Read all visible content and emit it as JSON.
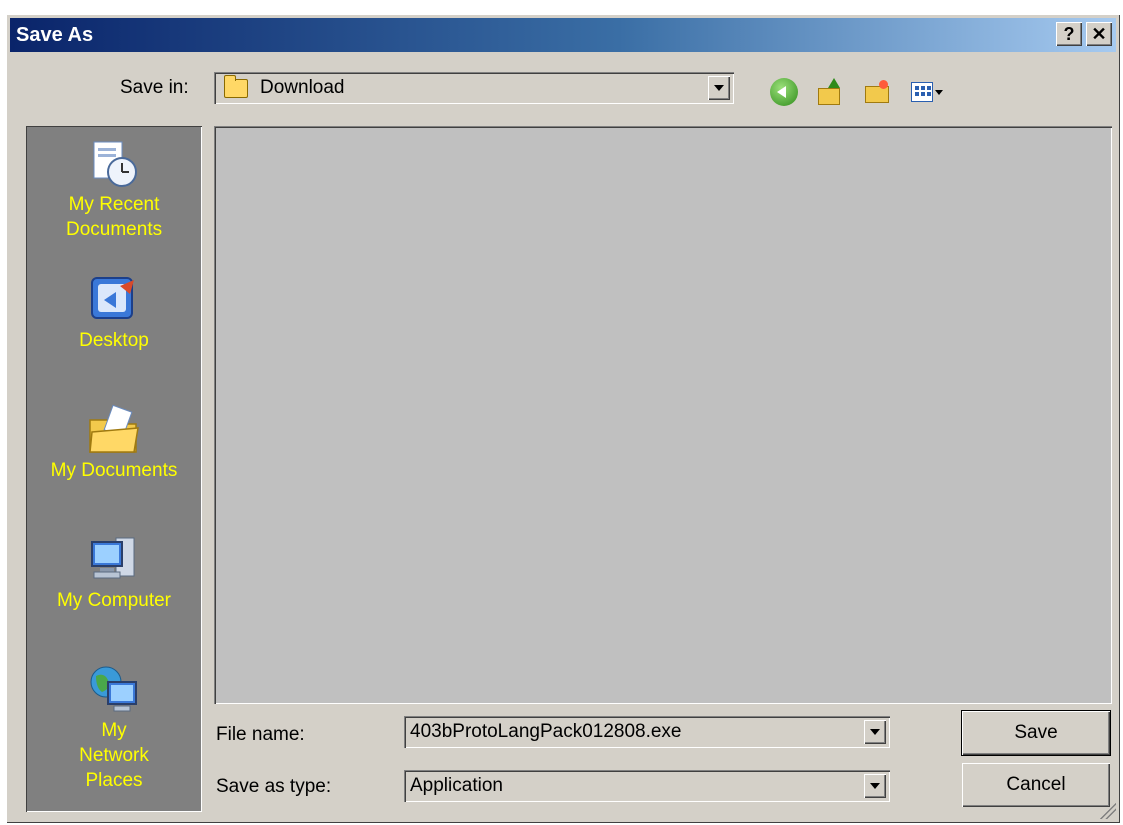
{
  "dialog": {
    "title": "Save As",
    "help_button": "?",
    "close_button": "✕"
  },
  "save_in": {
    "label": "Save in:",
    "value": "Download"
  },
  "toolbar": {
    "back": "back-icon",
    "up": "up-one-level-icon",
    "new_folder": "new-folder-icon",
    "views": "views-menu-icon"
  },
  "places": [
    {
      "label": "My Recent Documents"
    },
    {
      "label": "Desktop"
    },
    {
      "label": "My Documents"
    },
    {
      "label": "My Computer"
    },
    {
      "label": "My Network Places"
    }
  ],
  "file_name": {
    "label": "File name:",
    "value": "403bProtoLangPack012808.exe"
  },
  "save_as_type": {
    "label": "Save as type:",
    "value": "Application"
  },
  "buttons": {
    "save": "Save",
    "cancel": "Cancel"
  },
  "colors": {
    "title_start": "#0a246a",
    "title_end": "#a6caf0",
    "places_bg": "#808080",
    "places_text": "#ffff00",
    "dialog_bg": "#d4d0c8"
  }
}
